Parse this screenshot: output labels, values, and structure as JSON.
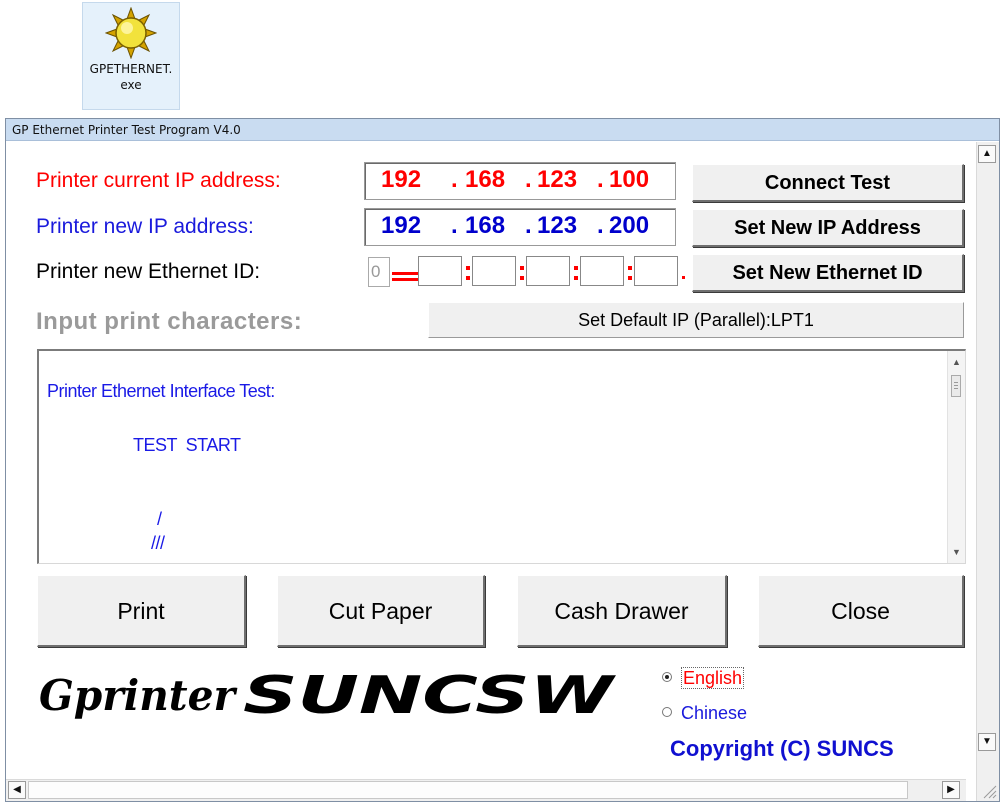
{
  "desktop_icon": {
    "label": "GPETHERNET.exe",
    "icon": "sun-icon"
  },
  "window": {
    "title": "GP Ethernet Printer Test Program  V4.0"
  },
  "form": {
    "current_ip_label": "Printer current IP address:",
    "current_ip": [
      "192",
      "168",
      "123",
      "100"
    ],
    "new_ip_label": "Printer new IP address:",
    "new_ip": [
      "192",
      "168",
      "123",
      "200"
    ],
    "ethernet_id_label": "Printer new Ethernet ID:",
    "ethernet_first": "0",
    "input_label": "Input print characters:"
  },
  "buttons": {
    "connect_test": "Connect Test",
    "set_new_ip": "Set New IP Address",
    "set_new_ethernet": "Set New Ethernet ID",
    "set_default_ip": "Set Default IP (Parallel):LPT1",
    "print": "Print",
    "cut_paper": "Cut Paper",
    "cash_drawer": "Cash Drawer",
    "close": "Close"
  },
  "textarea": {
    "line1": "Printer Ethernet Interface Test:",
    "line2": "TEST  START",
    "line3": "/",
    "line4": "///"
  },
  "footer": {
    "logo_text": "GprinterSUNCSW",
    "languages": [
      {
        "label": "English",
        "selected": true,
        "color": "#ff0000"
      },
      {
        "label": "Chinese",
        "selected": false,
        "color": "#0000ff"
      }
    ],
    "copyright": "Copyright (C) SUNCS"
  },
  "colors": {
    "current_ip": "#ff0000",
    "new_ip": "#0000cc",
    "label_blue": "#1a1adc",
    "input_label_gray": "#9a9a9a"
  }
}
